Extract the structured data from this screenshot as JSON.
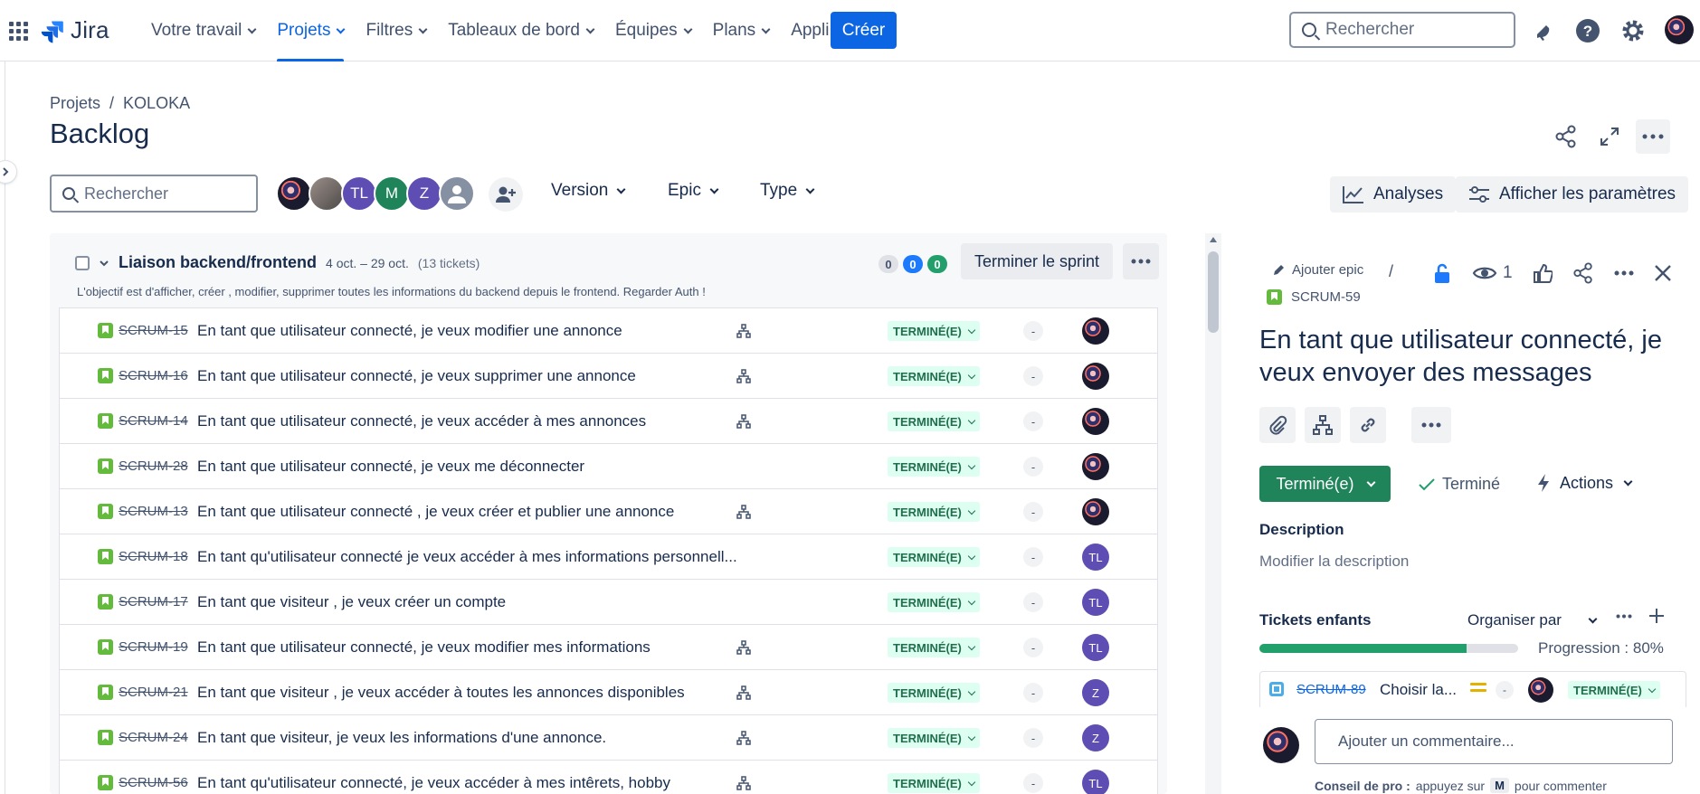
{
  "colors": {
    "brand": "#0c66e4",
    "done_green": "#1f845a",
    "status_bg": "#dcfff1",
    "status_fg": "#216e4e",
    "story": "#63ba3c"
  },
  "topnav": {
    "logo_text": "Jira",
    "items": [
      {
        "label": "Votre travail",
        "active": false
      },
      {
        "label": "Projets",
        "active": true
      },
      {
        "label": "Filtres",
        "active": false
      },
      {
        "label": "Tableaux de bord",
        "active": false
      },
      {
        "label": "Équipes",
        "active": false
      },
      {
        "label": "Plans",
        "active": false
      },
      {
        "label": "Appli",
        "active": false
      }
    ],
    "create_label": "Créer",
    "search_placeholder": "Rechercher",
    "icons": [
      "notifications-icon",
      "help-icon",
      "settings-icon",
      "profile-avatar"
    ]
  },
  "header": {
    "breadcrumb": [
      "Projets",
      "KOLOKA"
    ],
    "breadcrumb_sep": "/",
    "title": "Backlog"
  },
  "filters": {
    "search_placeholder": "Rechercher",
    "avatars": [
      {
        "initials": "",
        "color": "#1b1b2f"
      },
      {
        "initials": "",
        "color": "#7a6e6b"
      },
      {
        "initials": "TL",
        "color": "#5e4db2"
      },
      {
        "initials": "M",
        "color": "#1f845a"
      },
      {
        "initials": "Z",
        "color": "#5e4db2"
      },
      {
        "initials": "",
        "color": "#8590a2"
      }
    ],
    "dropdowns": [
      "Version",
      "Epic",
      "Type"
    ],
    "insights_label": "Analyses",
    "view_settings_label": "Afficher les paramètres"
  },
  "sprint": {
    "name": "Liaison backend/frontend",
    "dates": "4 oct. – 29 oct.",
    "count": "(13 tickets)",
    "goal": "L'objectif est d'afficher, créer , modifier, supprimer toutes les informations du backend depuis le frontend. Regarder Auth !",
    "counters": [
      {
        "value": "0",
        "bg": "#dfe1e6",
        "fg": "#44546f"
      },
      {
        "value": "0",
        "bg": "#1d7afc",
        "fg": "#ffffff"
      },
      {
        "value": "0",
        "bg": "#22a06b",
        "fg": "#ffffff"
      }
    ],
    "end_label": "Terminer le sprint",
    "issues": [
      {
        "key": "SCRUM-15",
        "summary": "En tant que utilisateur connecté, je veux modifier une annonce",
        "children": true,
        "status": "TERMINÉ(E)",
        "estimate": "-",
        "assignee": {
          "initials": "",
          "color": "#1b1b2f"
        }
      },
      {
        "key": "SCRUM-16",
        "summary": "En tant que utilisateur connecté, je veux supprimer une annonce",
        "children": true,
        "status": "TERMINÉ(E)",
        "estimate": "-",
        "assignee": {
          "initials": "",
          "color": "#1b1b2f"
        }
      },
      {
        "key": "SCRUM-14",
        "summary": "En tant que utilisateur connecté, je veux accéder à mes annonces",
        "children": true,
        "status": "TERMINÉ(E)",
        "estimate": "-",
        "assignee": {
          "initials": "",
          "color": "#1b1b2f"
        }
      },
      {
        "key": "SCRUM-28",
        "summary": "En tant que utilisateur connecté, je veux me déconnecter",
        "children": false,
        "status": "TERMINÉ(E)",
        "estimate": "-",
        "assignee": {
          "initials": "",
          "color": "#1b1b2f"
        }
      },
      {
        "key": "SCRUM-13",
        "summary": "En tant que utilisateur connecté , je veux créer et publier une annonce",
        "children": true,
        "status": "TERMINÉ(E)",
        "estimate": "-",
        "assignee": {
          "initials": "",
          "color": "#1b1b2f"
        }
      },
      {
        "key": "SCRUM-18",
        "summary": "En tant qu'utilisateur connecté je veux accéder à mes informations personnell...",
        "children": false,
        "status": "TERMINÉ(E)",
        "estimate": "-",
        "assignee": {
          "initials": "TL",
          "color": "#5e4db2"
        }
      },
      {
        "key": "SCRUM-17",
        "summary": "En tant que visiteur , je veux créer un compte",
        "children": false,
        "status": "TERMINÉ(E)",
        "estimate": "-",
        "assignee": {
          "initials": "TL",
          "color": "#5e4db2"
        }
      },
      {
        "key": "SCRUM-19",
        "summary": "En tant que utilisateur connecté, je veux modifier mes informations",
        "children": true,
        "status": "TERMINÉ(E)",
        "estimate": "-",
        "assignee": {
          "initials": "TL",
          "color": "#5e4db2"
        }
      },
      {
        "key": "SCRUM-21",
        "summary": "En tant que visiteur , je veux accéder à toutes les annonces disponibles",
        "children": true,
        "status": "TERMINÉ(E)",
        "estimate": "-",
        "assignee": {
          "initials": "Z",
          "color": "#5e4db2"
        }
      },
      {
        "key": "SCRUM-24",
        "summary": "En tant que visiteur, je veux les informations d'une annonce.",
        "children": true,
        "status": "TERMINÉ(E)",
        "estimate": "-",
        "assignee": {
          "initials": "Z",
          "color": "#5e4db2"
        }
      },
      {
        "key": "SCRUM-56",
        "summary": "En tant qu'utilisateur connecté, je veux accéder à mes intêrets, hobby",
        "children": true,
        "status": "TERMINÉ(E)",
        "estimate": "-",
        "assignee": {
          "initials": "TL",
          "color": "#5e4db2"
        }
      }
    ]
  },
  "detail": {
    "add_epic_label": "Ajouter epic",
    "separator": "/",
    "issue_key": "SCRUM-59",
    "watch_count": "1",
    "title": "En tant que utilisateur connecté, je veux envoyer des messages",
    "status_label": "Terminé(e)",
    "resolution_label": "Terminé",
    "actions_label": "Actions",
    "description_label": "Description",
    "description_placeholder": "Modifier la description",
    "children_label": "Tickets enfants",
    "organize_label": "Organiser par",
    "progress_label": "Progression :  80%",
    "progress": 0.8,
    "child": {
      "key": "SCRUM-89",
      "summary": "Choisir la...",
      "estimate": "-",
      "status": "TERMINÉ(E)"
    },
    "comment_placeholder": "Ajouter un commentaire...",
    "protip_bold": "Conseil de pro :",
    "protip_text": "appuyez sur",
    "protip_key": "M",
    "protip_end": "pour commenter"
  }
}
